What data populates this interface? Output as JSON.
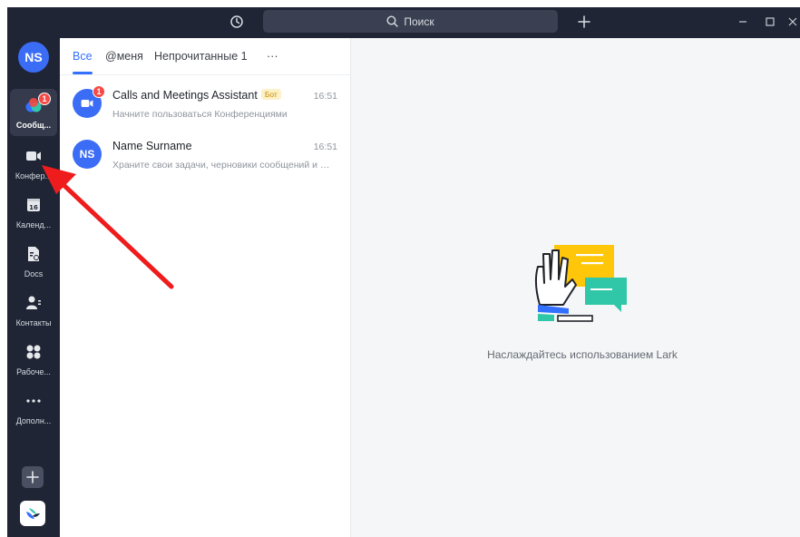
{
  "titlebar": {
    "search_label": "Поиск",
    "history_icon": "history-icon",
    "plus_icon": "plus-icon"
  },
  "user": {
    "initials": "NS"
  },
  "sidebar": {
    "items": [
      {
        "label": "Сообщ...",
        "icon": "messages-icon",
        "badge": "1",
        "active": true
      },
      {
        "label": "Конфер...",
        "icon": "video-camera-icon"
      },
      {
        "label": "Календ...",
        "icon": "calendar-icon"
      },
      {
        "label": "Docs",
        "icon": "docs-icon"
      },
      {
        "label": "Контакты",
        "icon": "contacts-icon"
      },
      {
        "label": "Рабоче...",
        "icon": "workplace-icon"
      },
      {
        "label": "Дополн...",
        "icon": "more-dots-icon"
      }
    ],
    "calendar_day": "16"
  },
  "tabs": {
    "all": "Все",
    "mentions": "@меня",
    "unread": "Непрочитанные 1",
    "more": "···"
  },
  "chats": [
    {
      "name": "Calls and Meetings Assistant",
      "tag": "Бот",
      "time": "16:51",
      "preview": "Начните пользоваться Конференциями",
      "badge": "1"
    },
    {
      "name": "Name Surname",
      "initials": "NS",
      "time": "16:51",
      "preview": "Храните свои задачи, черновики сообщений и файлы"
    }
  ],
  "main": {
    "welcome": "Наслаждайтесь использованием Lark"
  },
  "colors": {
    "accent": "#3370ff",
    "sidebar_bg": "#1f2535",
    "badge": "#f54a45",
    "annotation_arrow": "#ee1c1c"
  }
}
